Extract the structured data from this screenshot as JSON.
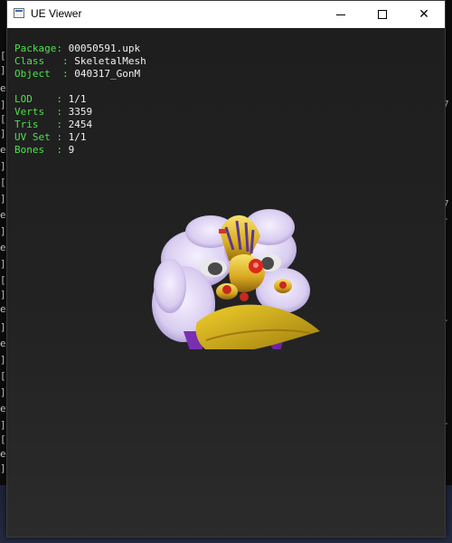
{
  "window": {
    "title": "UE Viewer",
    "controls": {
      "minimize": "minimize",
      "maximize": "maximize",
      "close": "✕"
    }
  },
  "info": {
    "package_label": "Package",
    "package_value": "00050591.upk",
    "class_label": "Class",
    "class_value": "SkeletalMesh",
    "object_label": "Object",
    "object_value": "040317_GonM",
    "lod_label": "LOD",
    "lod_value": "1/1",
    "verts_label": "Verts",
    "verts_value": "3359",
    "tris_label": "Tris",
    "tris_value": "2454",
    "uvset_label": "UV Set",
    "uvset_value": "1/1",
    "bones_label": "Bones",
    "bones_value": "9"
  },
  "colors": {
    "label": "#4fe04f",
    "value": "#f2f2f2",
    "viewport_bg": "#202020"
  },
  "model": {
    "icon": "lion-head-mesh"
  }
}
